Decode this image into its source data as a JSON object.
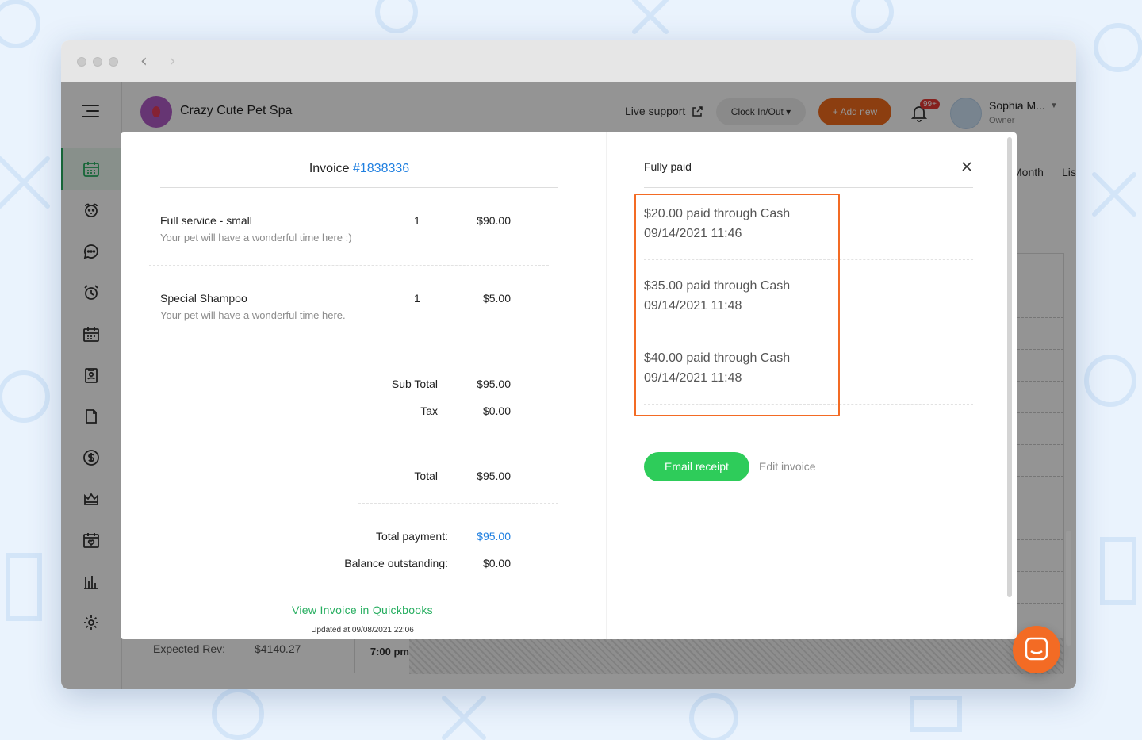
{
  "app": {
    "brand_name": "Crazy Cute Pet Spa",
    "live_support": "Live support",
    "clock_in_out": "Clock In/Out",
    "add_new": "+ Add new",
    "notifications_badge": "99+",
    "user_name": "Sophia M...",
    "user_role": "Owner",
    "view_tabs": [
      "Month",
      "Lis"
    ],
    "expected_rev_label": "Expected Rev:",
    "expected_rev_value": "$4140.27",
    "calendar_time": "7:00 pm"
  },
  "invoice": {
    "title_prefix": "Invoice",
    "number": "#1838336",
    "items": [
      {
        "name": "Full service - small",
        "description": "Your pet will have a wonderful time here :)",
        "qty": "1",
        "price": "$90.00"
      },
      {
        "name": "Special Shampoo",
        "description": "Your pet will have a wonderful time here.",
        "qty": "1",
        "price": "$5.00"
      }
    ],
    "subtotal_label": "Sub Total",
    "subtotal_value": "$95.00",
    "tax_label": "Tax",
    "tax_value": "$0.00",
    "total_label": "Total",
    "total_value": "$95.00",
    "total_payment_label": "Total payment:",
    "total_payment_value": "$95.00",
    "balance_label": "Balance outstanding:",
    "balance_value": "$0.00",
    "quickbooks_link": "View Invoice in Quickbooks",
    "updated_at": "Updated at 09/08/2021 22:06"
  },
  "payments": {
    "status": "Fully paid",
    "entries": [
      {
        "amount_line": "$20.00 paid through Cash",
        "timestamp": "09/14/2021 11:46"
      },
      {
        "amount_line": "$35.00 paid through Cash",
        "timestamp": "09/14/2021 11:48"
      },
      {
        "amount_line": "$40.00 paid through Cash",
        "timestamp": "09/14/2021 11:48"
      }
    ],
    "email_receipt": "Email receipt",
    "edit_invoice": "Edit invoice"
  },
  "colors": {
    "accent_green": "#2ecc5a",
    "link_blue": "#1f7fe0",
    "brand_orange": "#f26b1d",
    "highlight_orange": "#f36b24"
  },
  "icons": [
    "menu-icon",
    "calendar-icon",
    "dog-icon",
    "chat-icon",
    "alarm-icon",
    "schedule-icon",
    "badge-icon",
    "phone-icon",
    "dollar-icon",
    "crown-icon",
    "calendar-heart-icon",
    "bar-chart-icon",
    "gear-icon",
    "external-link-icon",
    "bell-icon",
    "close-icon",
    "messenger-icon"
  ]
}
